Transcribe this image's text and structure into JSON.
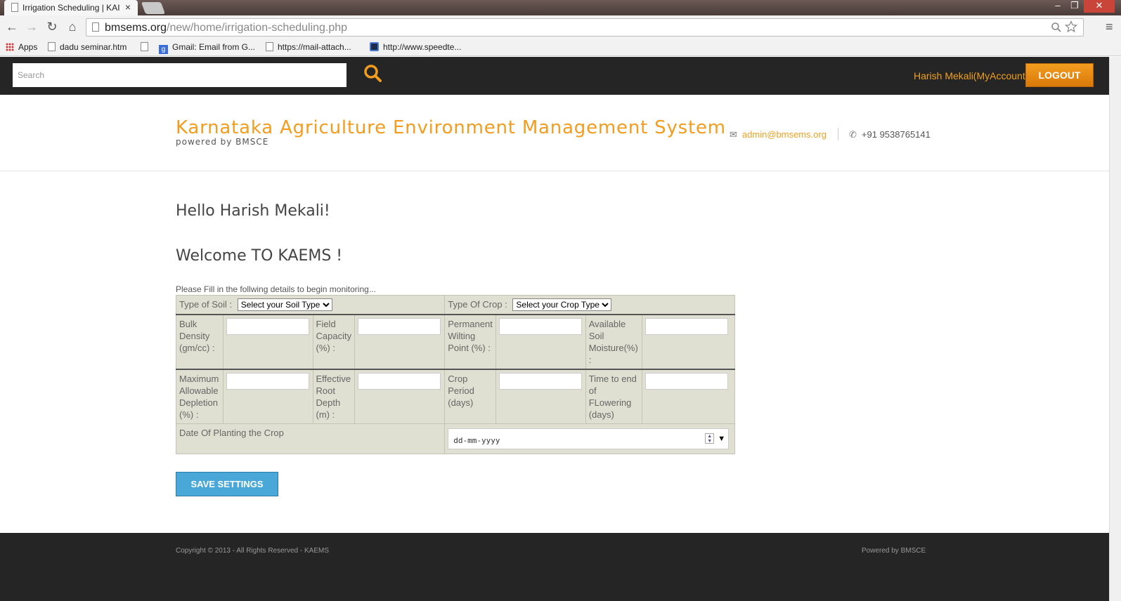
{
  "browser": {
    "tab_title": "Irrigation Scheduling | KAI",
    "tab_close": "×",
    "url_host": "bmsems.org",
    "url_path": "/new/home/irrigation-scheduling.php",
    "nav_back": "←",
    "nav_forward": "→",
    "nav_reload": "↻",
    "nav_home": "⌂",
    "menu_icon": "≡",
    "window_min": "–",
    "window_max": "❐",
    "window_close": "✕",
    "bookmarks": [
      {
        "label": "Apps",
        "icon": "apps-icon"
      },
      {
        "label": "dadu seminar.htm",
        "icon": "page-icon"
      },
      {
        "label": "",
        "icon": "page-icon"
      },
      {
        "label": "Gmail: Email from G...",
        "icon": "google-icon"
      },
      {
        "label": "https://mail-attach...",
        "icon": "page-icon"
      },
      {
        "label": "http://www.speedte...",
        "icon": "speedtest-icon"
      }
    ]
  },
  "topbar": {
    "search_placeholder": "Search",
    "user_link": "Harish Mekali(MyAccount)",
    "logout_label": "LOGOUT",
    "accent_color": "#f39d20"
  },
  "header": {
    "brand": "Karnataka Agriculture Environment Management System",
    "tagline": "powered by BMSCE",
    "email": "admin@bmsems.org",
    "phone": "+91 9538765141"
  },
  "main": {
    "greeting": "Hello Harish Mekali!",
    "welcome": "Welcome TO KAEMS !",
    "instructions": "Please Fill in the follwing details to begin monitoring...",
    "soil_label": "Type of Soil :",
    "soil_select": "Select your Soil Type",
    "crop_label": "Type Of Crop :",
    "crop_select": "Select your Crop Type",
    "fields": {
      "bulk_density": "Bulk Density (gm/cc) :",
      "field_capacity": "Field Capacity (%) :",
      "pwp": "Permanent Wilting Point (%) :",
      "asm": "Available Soil Moisture(%) :",
      "mad": "Maximum Allowable Depletion (%) :",
      "erd": "Effective Root Depth (m) :",
      "crop_period": "Crop Period (days)",
      "flowering": "Time to end of FLowering (days)"
    },
    "date_label": "Date Of Planting the Crop",
    "date_placeholder": "dd-mm-yyyy",
    "save_label": "SAVE SETTINGS"
  },
  "footer": {
    "copyright": "Copyright © 2013 - All Rights Reserved - KAEMS",
    "powered": "Powered by BMSCE"
  }
}
